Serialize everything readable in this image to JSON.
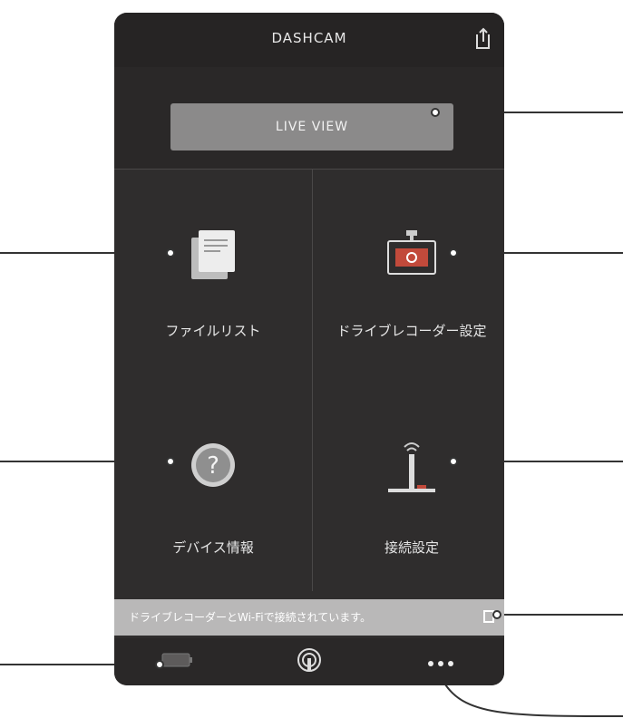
{
  "header": {
    "title": "DASHCAM"
  },
  "live_view": {
    "label": "LIVE VIEW"
  },
  "menu": [
    {
      "key": "file_list",
      "label": "ファイルリスト",
      "icon": "file-list-icon"
    },
    {
      "key": "recorder_settings",
      "label": "ドライブレコーダー設定",
      "icon": "dashcam-settings-icon"
    },
    {
      "key": "device_info",
      "label": "デバイス情報",
      "icon": "question-icon"
    },
    {
      "key": "network_settings",
      "label": "接続設定",
      "icon": "wifi-router-icon"
    }
  ],
  "notice": {
    "text": "ドライブレコーダーとWi-Fiで接続されています。"
  },
  "tabs": [
    {
      "key": "battery",
      "icon": "battery-icon"
    },
    {
      "key": "connect",
      "icon": "wifi-connect-icon"
    },
    {
      "key": "more",
      "icon": "more-dots-icon"
    }
  ],
  "colors": {
    "phone_bg": "#2f2d2d",
    "header_bg": "#262424",
    "live_button": "#8b8a8a",
    "notice_bar": "#b9b8b8"
  }
}
